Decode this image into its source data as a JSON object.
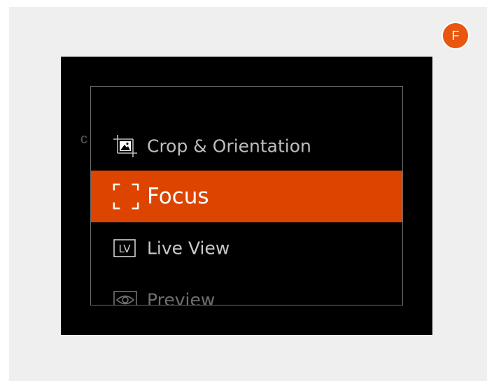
{
  "badge": {
    "letter": "F"
  },
  "screen": {
    "stray_char": "c",
    "menu": {
      "items": [
        {
          "label": "Crop & Orientation",
          "icon": "crop-icon",
          "selected": false
        },
        {
          "label": "Focus",
          "icon": "focus-frame-icon",
          "selected": true
        },
        {
          "label": "Live View",
          "icon": "live-view-icon",
          "icon_text": "LV",
          "selected": false
        },
        {
          "label": "Preview",
          "icon": "preview-eye-icon",
          "selected": false
        }
      ]
    }
  },
  "colors": {
    "page_background": "#efefef",
    "screen_background": "#000000",
    "accent": "#dd4400",
    "badge": "#e8560f"
  }
}
